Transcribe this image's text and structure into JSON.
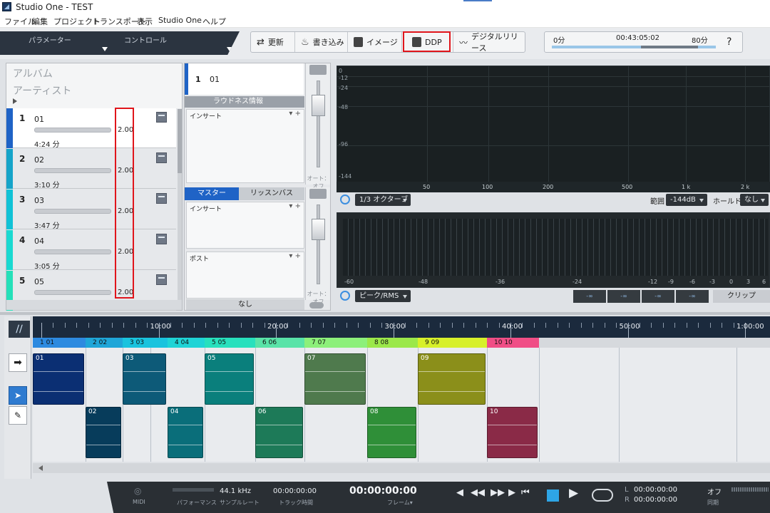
{
  "window": {
    "title": "Studio One - TEST"
  },
  "menu": [
    "ファイル",
    "編集",
    "プロジェクト",
    "トランスポート",
    "表示",
    "Studio One",
    "ヘルプ"
  ],
  "tabs": {
    "parameters": "パラメーター",
    "controls": "コントロール"
  },
  "toolbar": {
    "update": "更新",
    "write": "書き込み",
    "image": "イメージ",
    "ddp": "DDP",
    "digital_release": "デジタルリリース"
  },
  "mini_transport": {
    "start": "0分",
    "time": "00:43:05:02",
    "end": "80分",
    "help": "?"
  },
  "album": {
    "album_placeholder": "アルバム",
    "artist_placeholder": "アーティスト",
    "tracks": [
      {
        "num": "1",
        "name": "01",
        "gain": "2.00",
        "duration": "4:24 分",
        "color": "#1f63c6"
      },
      {
        "num": "2",
        "name": "02",
        "gain": "2.00",
        "duration": "3:10 分",
        "color": "#15a4c9"
      },
      {
        "num": "3",
        "name": "03",
        "gain": "2.00",
        "duration": "3:47 分",
        "color": "#10c2d6"
      },
      {
        "num": "4",
        "name": "04",
        "gain": "2.00",
        "duration": "3:05 分",
        "color": "#19d9d1"
      },
      {
        "num": "5",
        "name": "05",
        "gain": "2.00",
        "duration": "",
        "color": "#25e0b9"
      }
    ]
  },
  "middle": {
    "selected_num": "1",
    "selected_name": "01",
    "loudness": "ラウドネス情報",
    "insert": "インサート",
    "master_tab": "マスター",
    "listen_tab": "リッスンバス",
    "post": "ポスト",
    "none": "なし",
    "auto_off": "オート：オフ"
  },
  "spectrum": {
    "db_labels": [
      "0",
      "-12",
      "-24",
      "-48",
      "-96",
      "-144"
    ],
    "freq_labels": [
      "50",
      "100",
      "200",
      "500",
      "1 k",
      "2 k"
    ],
    "mode": "1/3 オクターブ",
    "range_label": "範囲",
    "range_value": "-144dB",
    "hold_label": "ホールド",
    "hold_value": "なし"
  },
  "meter": {
    "scale": [
      "-60",
      "-48",
      "-36",
      "-24",
      "-12",
      "-9",
      "-6",
      "-3",
      "0",
      "3",
      "6"
    ],
    "mode": "ピーク/RMS",
    "readouts": [
      "-∞",
      "-∞",
      "-∞",
      "-∞"
    ],
    "clip": "クリップ"
  },
  "ruler": [
    "10:00",
    "20:00",
    "30:00",
    "40:00",
    "50:00",
    "1:00:00"
  ],
  "markers": [
    "1 01",
    "2 02",
    "3 03",
    "4 04",
    "5 05",
    "6 06",
    "7 07",
    "8 08",
    "9 09",
    "10 10"
  ],
  "clips": [
    {
      "label": "01",
      "color": "#0b2f73"
    },
    {
      "label": "02",
      "color": "#073c5b"
    },
    {
      "label": "03",
      "color": "#0d5a78"
    },
    {
      "label": "04",
      "color": "#0a6e7a"
    },
    {
      "label": "05",
      "color": "#0a7f7c"
    },
    {
      "label": "06",
      "color": "#1d7a58"
    },
    {
      "label": "07",
      "color": "#4f7a4d"
    },
    {
      "label": "08",
      "color": "#2f8f38"
    },
    {
      "label": "09",
      "color": "#8b8f1a"
    },
    {
      "label": "10",
      "color": "#8a2a47"
    }
  ],
  "bottom": {
    "midi": "MIDI",
    "performance": "パフォーマンス",
    "sample_rate_value": "44.1 kHz",
    "sample_rate": "サンプルレート",
    "track_time_value": "00:00:00:00",
    "track_time": "トラック時間",
    "main_time": "00:00:00:00",
    "frames": "フレーム▾",
    "l_label": "L",
    "r_label": "R",
    "l_time": "00:00:00:00",
    "r_time": "00:00:00:00",
    "sync_off": "オフ",
    "sync": "同期"
  },
  "colors": {
    "highlight": "#e0151b",
    "accent": "#1f63c6"
  }
}
